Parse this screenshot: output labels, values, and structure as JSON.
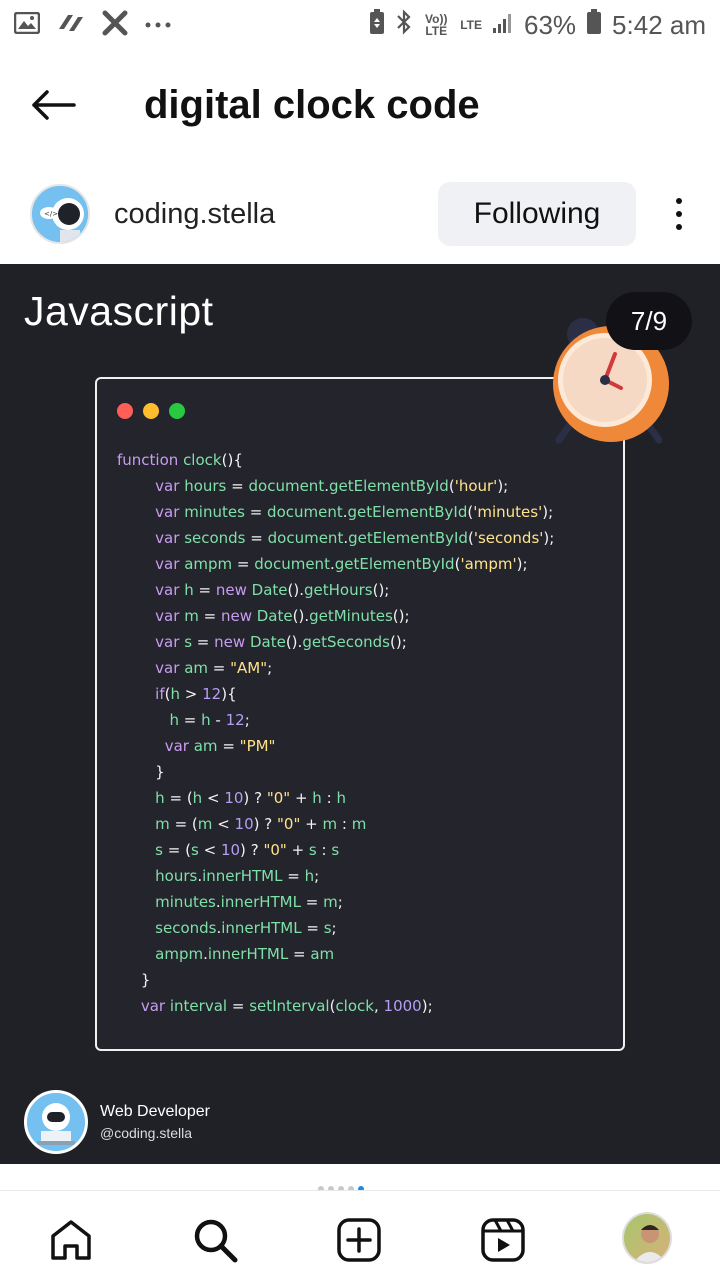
{
  "status_bar": {
    "battery": "63%",
    "time": "5:42 am",
    "volte": "Vo)) LTE",
    "network": "LTE",
    "left_icons": [
      "gallery-icon",
      "link-icon",
      "tools-icon",
      "more-dots-icon"
    ]
  },
  "header": {
    "title": "digital clock code"
  },
  "post_author": {
    "username": "coding.stella",
    "follow_label": "Following"
  },
  "post": {
    "heading": "Javascript",
    "counter": "7/9",
    "code_lines": [
      "function clock(){",
      "        var hours = document.getElementById('hour');",
      "        var minutes = document.getElementById('minutes');",
      "        var seconds = document.getElementById('seconds');",
      "        var ampm = document.getElementById('ampm');",
      "        var h = new Date().getHours();",
      "        var m = new Date().getMinutes();",
      "        var s = new Date().getSeconds();",
      "        var am = \"AM\";",
      "        if(h > 12){",
      "           h = h - 12;",
      "          var am = \"PM\"",
      "        }",
      "        h = (h < 10) ? \"0\" + h : h",
      "        m = (m < 10) ? \"0\" + m : m",
      "        s = (s < 10) ? \"0\" + s : s",
      "        hours.innerHTML = h;",
      "        minutes.innerHTML = m;",
      "        seconds.innerHTML = s;",
      "        ampm.innerHTML = am",
      "     }",
      "     var interval = setInterval(clock, 1000);"
    ],
    "creator_role": "Web Developer",
    "creator_handle": "@coding.stella"
  },
  "carousel": {
    "total": 5,
    "active": 4
  },
  "nav": {
    "items": [
      "home-icon",
      "search-icon",
      "create-icon",
      "reels-icon",
      "profile-avatar"
    ]
  },
  "colors": {
    "post_bg": "#202027",
    "window_dot_red": "#ff5f57",
    "window_dot_yellow": "#febc2e",
    "window_dot_green": "#28c840",
    "clock_orange": "#f0883a"
  }
}
